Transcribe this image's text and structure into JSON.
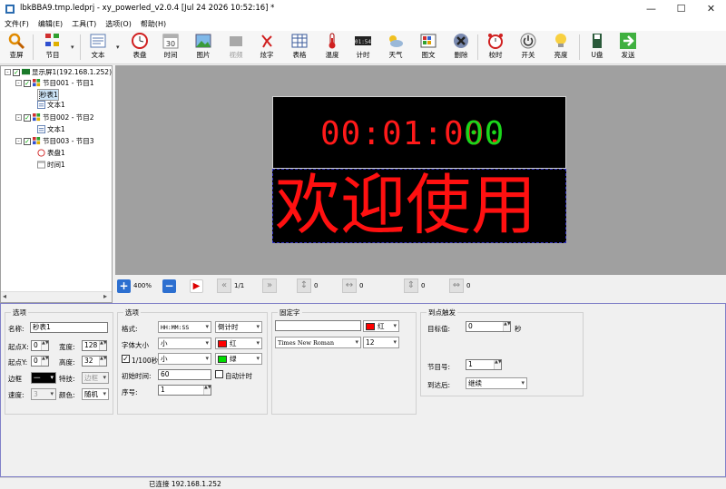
{
  "window": {
    "title": "lbkBBA9.tmp.ledprj - xy_powerled_v2.0.4  [Jul 24 2026 10:52:16] *",
    "minimize": "—",
    "maximize": "☐",
    "close": "✕"
  },
  "menu": [
    "文件(F)",
    "编辑(E)",
    "工具(T)",
    "选项(O)",
    "帮助(H)"
  ],
  "toolbar": {
    "items": [
      {
        "label": "查屏",
        "icon": "search-icon"
      },
      {
        "label": "节目",
        "icon": "program-icon"
      },
      {
        "label": "文本",
        "icon": "text-icon"
      },
      {
        "label": "表盘",
        "icon": "clock-dial-icon"
      },
      {
        "label": "时间",
        "icon": "calendar-icon"
      },
      {
        "label": "图片",
        "icon": "picture-icon"
      },
      {
        "label": "视频",
        "icon": "video-icon"
      },
      {
        "label": "炫字",
        "icon": "fancy-text-icon"
      },
      {
        "label": "表格",
        "icon": "table-icon"
      },
      {
        "label": "温度",
        "icon": "thermometer-icon"
      },
      {
        "label": "计时",
        "icon": "timer-icon"
      },
      {
        "label": "天气",
        "icon": "weather-icon"
      },
      {
        "label": "图文",
        "icon": "image-text-icon"
      },
      {
        "label": "删除",
        "icon": "delete-icon"
      },
      {
        "label": "校时",
        "icon": "alarm-clock-icon"
      },
      {
        "label": "开关",
        "icon": "power-icon"
      },
      {
        "label": "亮度",
        "icon": "bulb-icon"
      },
      {
        "label": "U盘",
        "icon": "usb-icon"
      },
      {
        "label": "发送",
        "icon": "send-icon"
      }
    ],
    "dropdown_arrow": "▾"
  },
  "tree": {
    "expander": "-",
    "check": "✓",
    "screen": "显示屏1(192.168.1.252)",
    "programs": [
      {
        "label": "节目001 - 节目1",
        "children": [
          "秒表1",
          "文本1"
        ]
      },
      {
        "label": "节目002 - 节目2",
        "children": [
          "文本1"
        ]
      },
      {
        "label": "节目003 - 节目3",
        "children": [
          "表盘1",
          "时间1"
        ]
      }
    ]
  },
  "preview": {
    "timer_main": "00:01:00.",
    "timer_fraction": "00",
    "welcome": "欢迎使用",
    "colors": {
      "led_red": "#ff1a1a",
      "led_green": "#1bd61b",
      "bg": "#000000"
    }
  },
  "preview_toolbar": {
    "zoom": "400%",
    "page": "1/1",
    "v1": "0",
    "v2": "0",
    "v3": "0",
    "v4": "0"
  },
  "props": {
    "g1": {
      "title": "选项",
      "name_label": "名称:",
      "name_value": "秒表1",
      "x_label": "起点X:",
      "x_value": "0",
      "width_label": "宽度:",
      "width_value": "128",
      "y_label": "起点Y:",
      "y_value": "0",
      "height_label": "高度:",
      "height_value": "32",
      "border_label": "边框",
      "border_value": "一",
      "effect_label": "特技:",
      "effect_value": "边框",
      "speed_label": "速度:",
      "speed_value": "3",
      "color_label": "颜色:",
      "color_value": "随机"
    },
    "g2": {
      "title": "选项",
      "format_label": "格式:",
      "format_value": "HH:MM:SS",
      "mode_value": "倒计时",
      "fontsize_label": "字体大小",
      "fontsize_value": "小",
      "color1_value": "红",
      "color1_hex": "#ff0000",
      "centisec_label": "1/100秒",
      "centisec_size": "小",
      "color2_value": "绿",
      "color2_hex": "#00dd00",
      "init_label": "初始时间:",
      "init_value": "60",
      "auto_label": "自动计时",
      "seq_label": "序号:",
      "seq_value": "1"
    },
    "g3": {
      "title": "固定字",
      "text_value": "",
      "color_value": "红",
      "color_hex": "#ff0000",
      "font_value": "Times New Roman",
      "size_value": "12"
    },
    "g4": {
      "title": "到点触发",
      "target_label": "目标值:",
      "target_value": "0",
      "target_unit": "秒",
      "prog_label": "节目号:",
      "prog_value": "1",
      "after_label": "到达后:",
      "after_value": "继续"
    }
  },
  "status": "已连接 192.168.1.252"
}
